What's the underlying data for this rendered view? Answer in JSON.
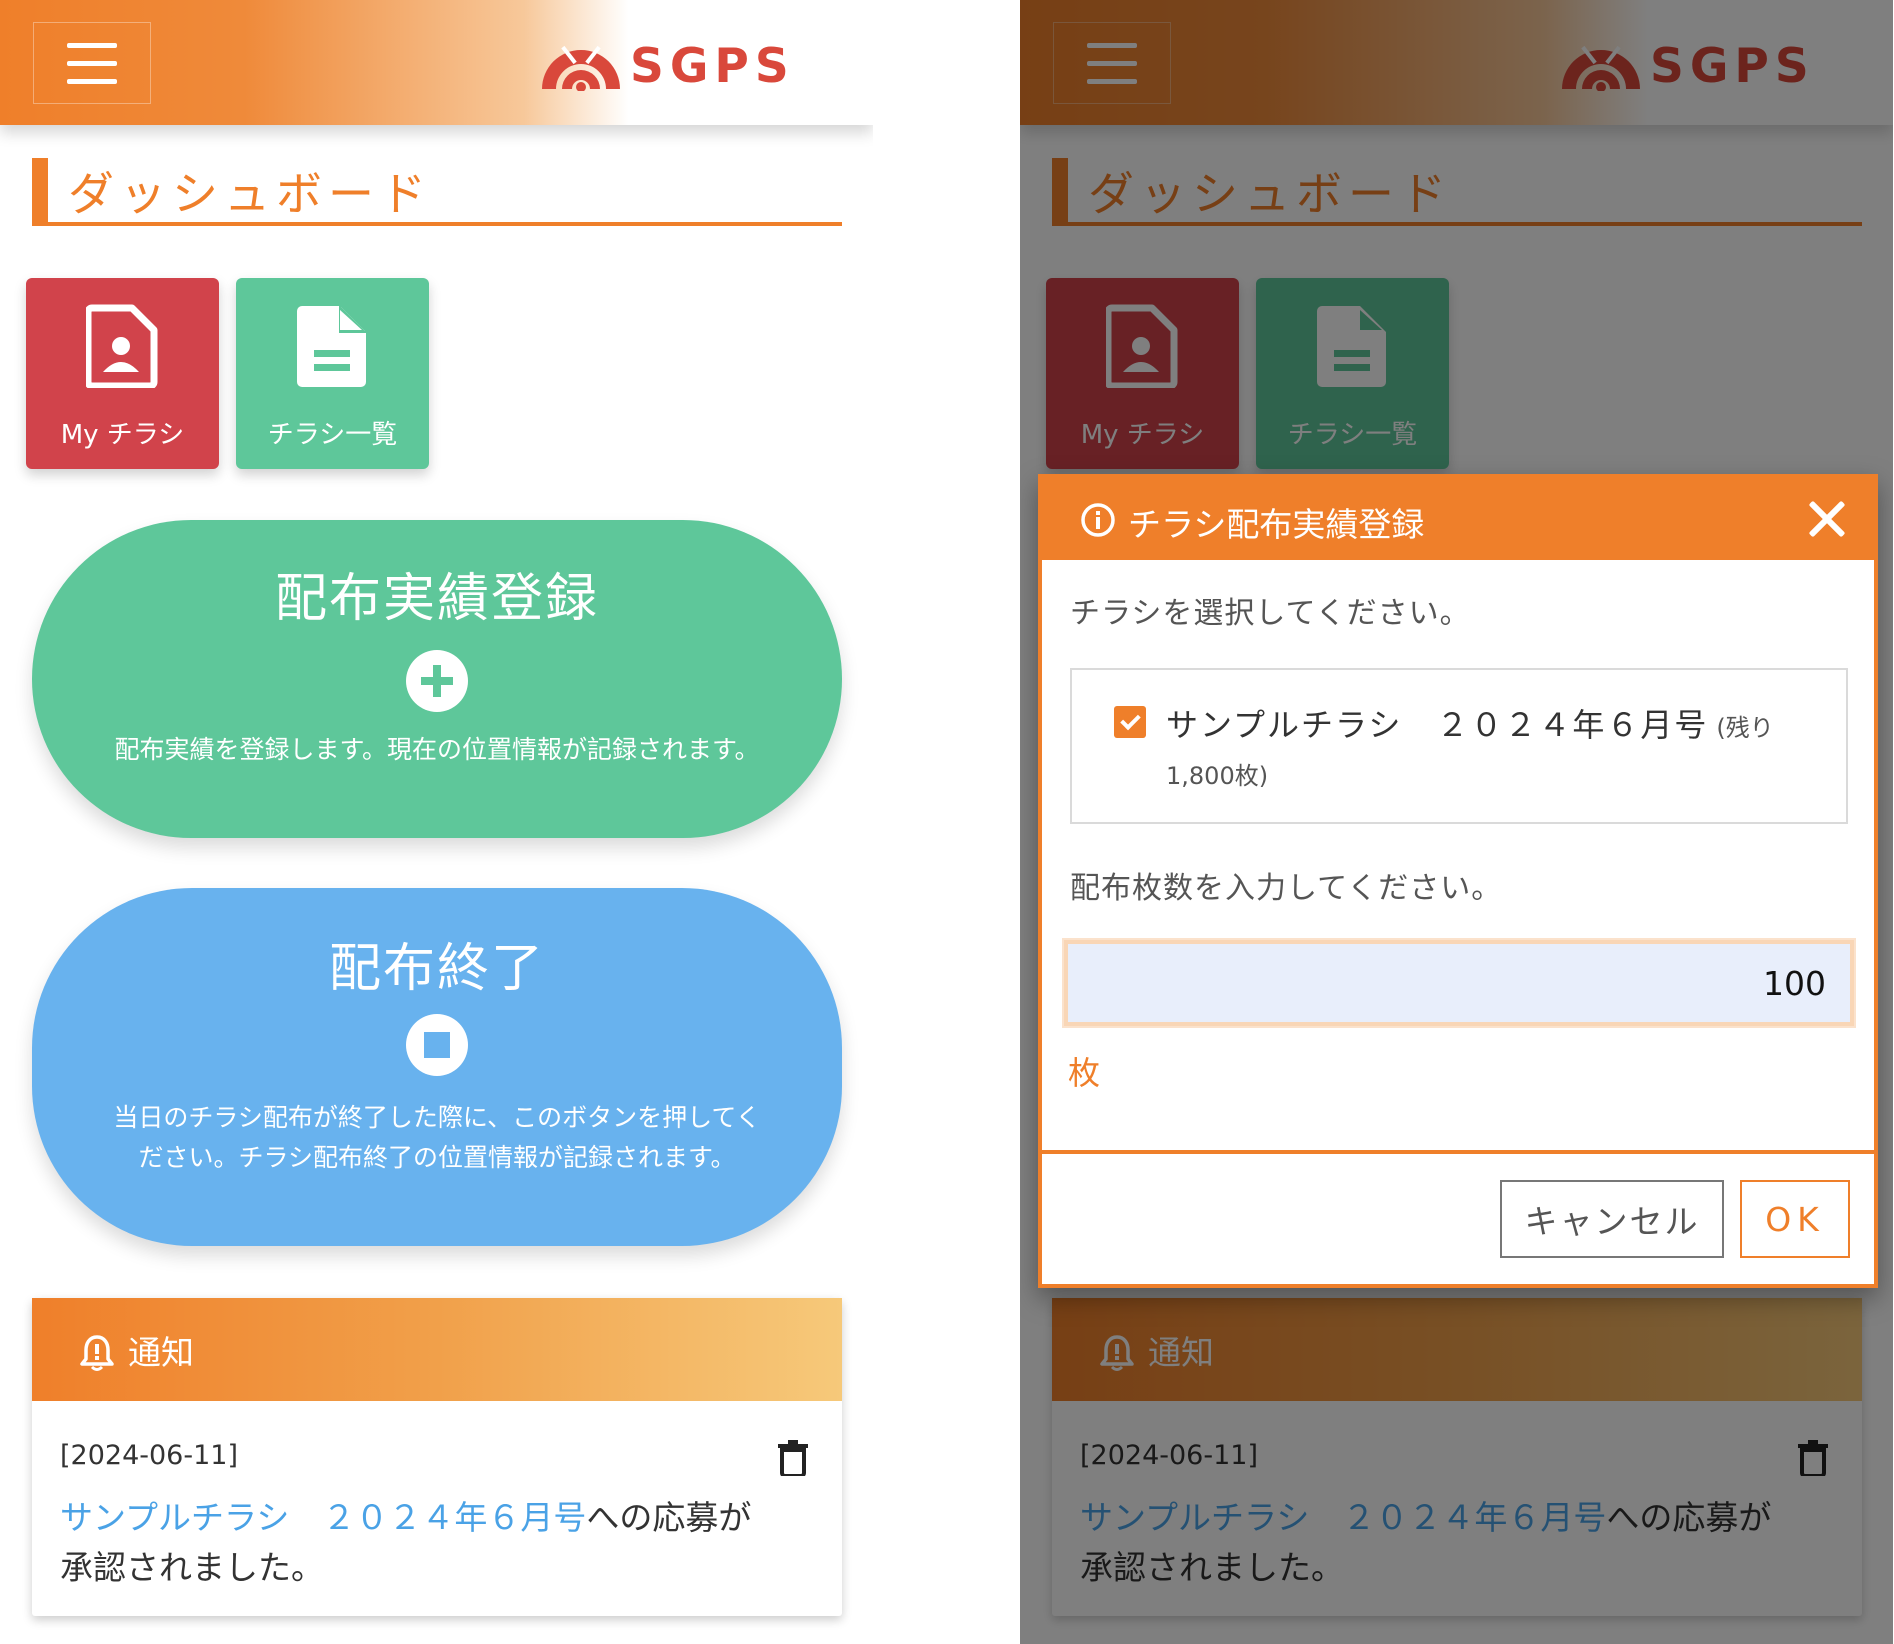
{
  "brand": {
    "name": "SGPS",
    "color": "#d9483b"
  },
  "colors": {
    "accent": "#ef7f2a",
    "tile_red": "#d1434b",
    "tile_green": "#5ec79a",
    "pill_blue": "#68b2ee",
    "link": "#4aa2e6"
  },
  "dashboard": {
    "title": "ダッシュボード",
    "tiles": [
      {
        "label": "My チラシ",
        "icon": "profile-document-icon"
      },
      {
        "label": "チラシ一覧",
        "icon": "document-list-icon"
      }
    ],
    "register": {
      "title": "配布実績登録",
      "icon": "plus-circle-icon",
      "description": "配布実績を登録します。現在の位置情報が記録されます。"
    },
    "finish": {
      "title": "配布終了",
      "icon": "stop-circle-icon",
      "description": "当日のチラシ配布が終了した際に、このボタンを押してください。チラシ配布終了の位置情報が記録されます。"
    },
    "notice": {
      "title": "通知",
      "date": "[2024-06-11]",
      "link_text": "サンプルチラシ　２０２４年６月号",
      "message": "への応募が承認されました。"
    }
  },
  "modal": {
    "title": "チラシ配布実績登録",
    "select_prompt": "チラシを選択してください。",
    "option_label": "サンプルチラシ　２０２４年６月号",
    "option_remaining_prefix": "(残り",
    "option_remaining_value": "1,800枚)",
    "option_checked": true,
    "count_prompt": "配布枚数を入力してください。",
    "count_value": "100",
    "unit": "枚",
    "cancel_label": "キャンセル",
    "ok_label": "OK"
  }
}
